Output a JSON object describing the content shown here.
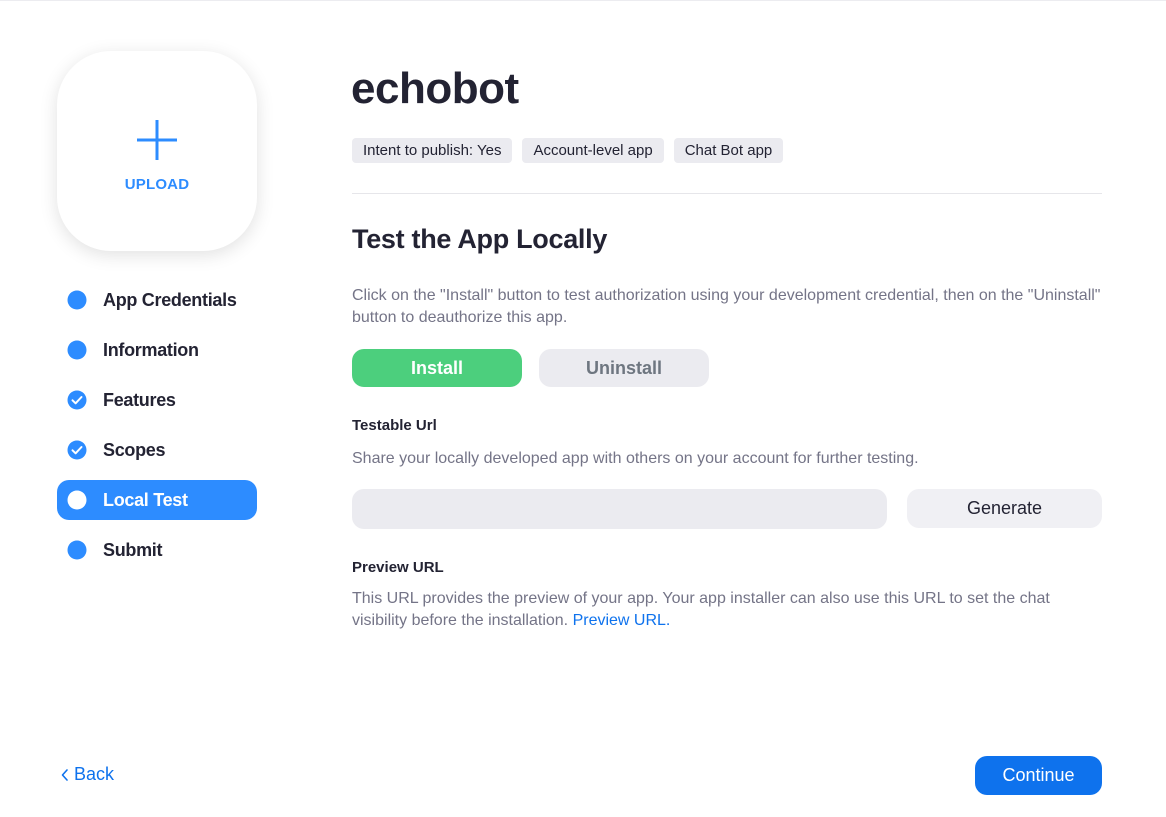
{
  "upload": {
    "label": "UPLOAD",
    "icon": "plus-icon"
  },
  "steps": [
    {
      "label": "App Credentials",
      "status": "filled",
      "icon": "dot-icon"
    },
    {
      "label": "Information",
      "status": "filled",
      "icon": "dot-icon"
    },
    {
      "label": "Features",
      "status": "complete",
      "icon": "check-circle-icon"
    },
    {
      "label": "Scopes",
      "status": "complete",
      "icon": "check-circle-icon"
    },
    {
      "label": "Local Test",
      "status": "active",
      "icon": "dot-icon"
    },
    {
      "label": "Submit",
      "status": "filled",
      "icon": "dot-icon"
    }
  ],
  "app": {
    "title": "echobot",
    "tags": [
      "Intent to publish: Yes",
      "Account-level app",
      "Chat Bot app"
    ]
  },
  "local_test": {
    "title": "Test the App Locally",
    "description": "Click on the \"Install\" button to test authorization using your development credential, then on the \"Uninstall\" button to deauthorize this app.",
    "install_label": "Install",
    "uninstall_label": "Uninstall"
  },
  "testable_url": {
    "label": "Testable Url",
    "description": "Share your locally developed app with others on your account for further testing.",
    "value": "",
    "generate_label": "Generate"
  },
  "preview_url": {
    "label": "Preview URL",
    "description": "This URL provides the preview of your app. Your app installer can also use this URL to set the chat visibility before the installation.",
    "link_text": "Preview URL."
  },
  "footer": {
    "back_label": "Back",
    "continue_label": "Continue"
  },
  "colors": {
    "accent": "#2d8cff",
    "link": "#0e72ed",
    "install_green": "#4ccf7d",
    "text_dark": "#232333",
    "text_muted": "#747487"
  }
}
